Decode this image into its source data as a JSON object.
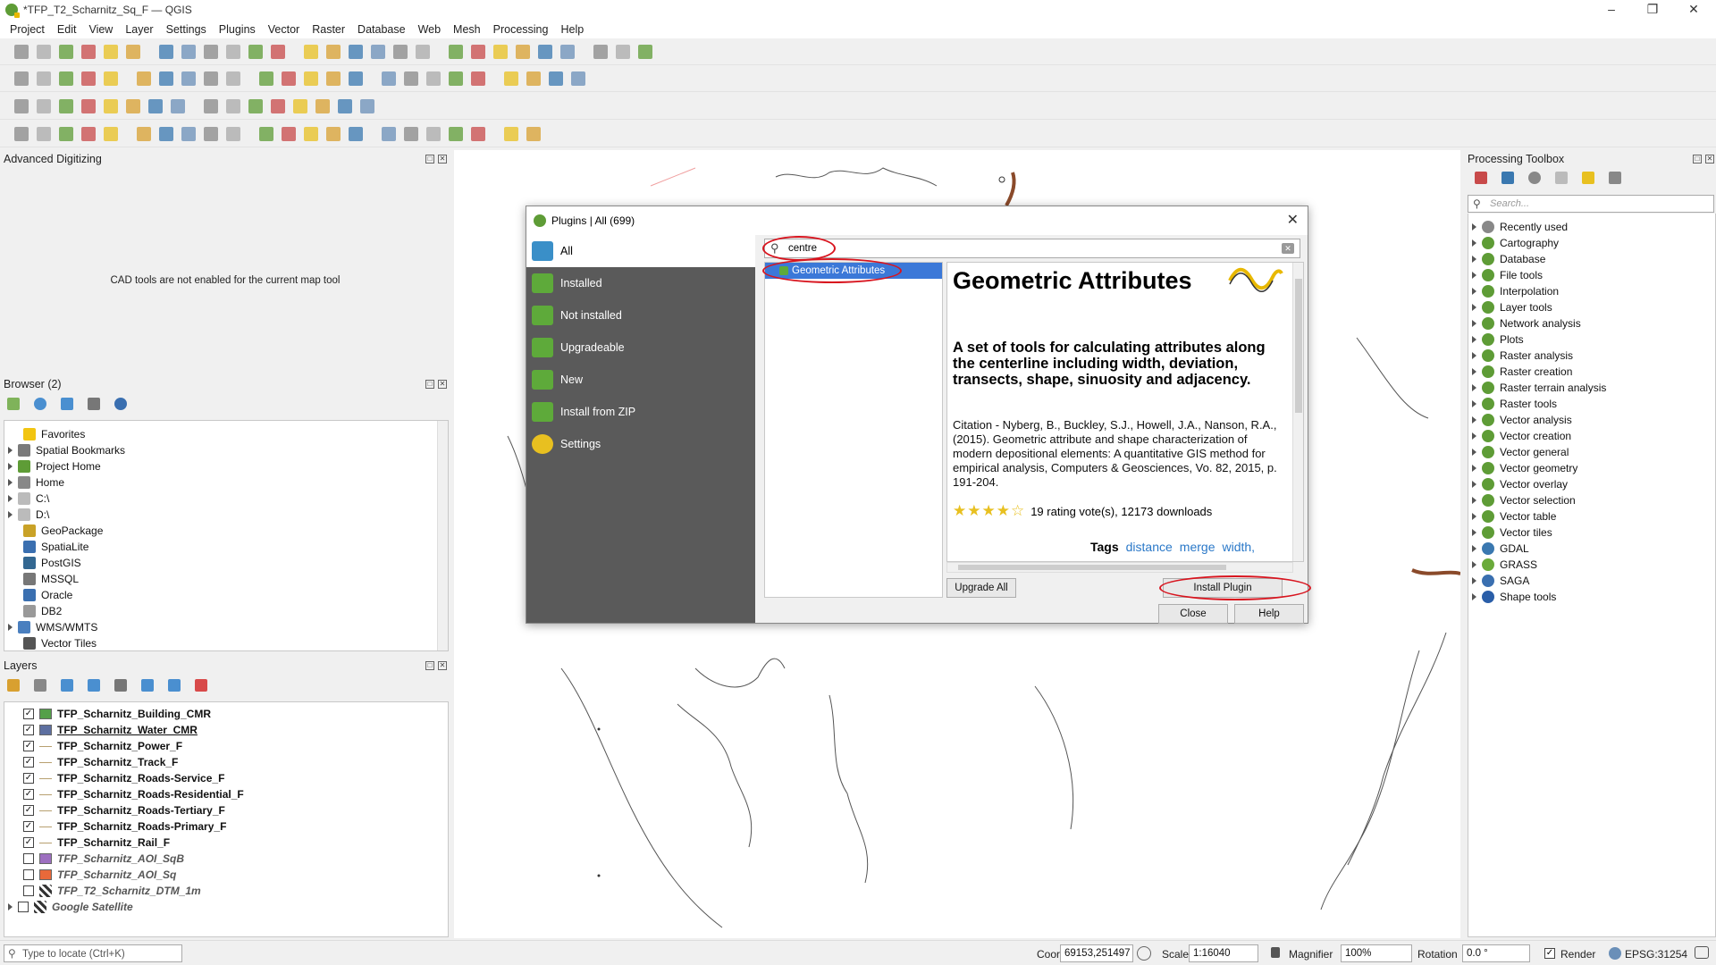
{
  "window": {
    "title": "*TFP_T2_Scharnitz_Sq_F — QGIS"
  },
  "menu": [
    "Project",
    "Edit",
    "View",
    "Layer",
    "Settings",
    "Plugins",
    "Vector",
    "Raster",
    "Database",
    "Web",
    "Mesh",
    "Processing",
    "Help"
  ],
  "advanced_digitizing": {
    "title": "Advanced Digitizing",
    "message": "CAD tools are not enabled for the current map tool"
  },
  "browser": {
    "title": "Browser (2)",
    "items": [
      {
        "label": "Favorites",
        "arrow": false,
        "icon": "star-icon",
        "color": "#f2c511"
      },
      {
        "label": "Spatial Bookmarks",
        "arrow": true,
        "icon": "bookmark-icon",
        "color": "#7a7a7a"
      },
      {
        "label": "Project Home",
        "arrow": true,
        "icon": "folder-icon",
        "color": "#5e9c36"
      },
      {
        "label": "Home",
        "arrow": true,
        "icon": "home-icon",
        "color": "#888"
      },
      {
        "label": "C:\\",
        "arrow": true,
        "icon": "drive-icon",
        "color": "#bbb"
      },
      {
        "label": "D:\\",
        "arrow": true,
        "icon": "drive-icon",
        "color": "#bbb"
      },
      {
        "label": "GeoPackage",
        "arrow": false,
        "icon": "geopackage-icon",
        "color": "#c9a227"
      },
      {
        "label": "SpatiaLite",
        "arrow": false,
        "icon": "spatialite-icon",
        "color": "#3a6fb0"
      },
      {
        "label": "PostGIS",
        "arrow": false,
        "icon": "postgis-icon",
        "color": "#336791"
      },
      {
        "label": "MSSQL",
        "arrow": false,
        "icon": "mssql-icon",
        "color": "#777"
      },
      {
        "label": "Oracle",
        "arrow": false,
        "icon": "oracle-icon",
        "color": "#3a6fb0"
      },
      {
        "label": "DB2",
        "arrow": false,
        "icon": "db2-icon",
        "color": "#999"
      },
      {
        "label": "WMS/WMTS",
        "arrow": true,
        "icon": "wms-icon",
        "color": "#4a7fbf"
      },
      {
        "label": "Vector Tiles",
        "arrow": false,
        "icon": "vector-tiles-icon",
        "color": "#555"
      }
    ]
  },
  "layers": {
    "title": "Layers",
    "items": [
      {
        "label": "TFP_Scharnitz_Building_CMR",
        "checked": true,
        "symbol": "fill",
        "color": "#55a04a",
        "italic": false
      },
      {
        "label": "TFP_Scharnitz_Water_CMR",
        "checked": true,
        "symbol": "fill",
        "color": "#5d6fa0",
        "italic": false,
        "underline": true
      },
      {
        "label": "TFP_Scharnitz_Power_F",
        "checked": true,
        "symbol": "line",
        "color": "#b8a070",
        "italic": false
      },
      {
        "label": "TFP_Scharnitz_Track_F",
        "checked": true,
        "symbol": "line",
        "color": "#b8a070",
        "italic": false
      },
      {
        "label": "TFP_Scharnitz_Roads-Service_F",
        "checked": true,
        "symbol": "line",
        "color": "#b8a070",
        "italic": false
      },
      {
        "label": "TFP_Scharnitz_Roads-Residential_F",
        "checked": true,
        "symbol": "line",
        "color": "#b8a070",
        "italic": false
      },
      {
        "label": "TFP_Scharnitz_Roads-Tertiary_F",
        "checked": true,
        "symbol": "line",
        "color": "#b8a070",
        "italic": false
      },
      {
        "label": "TFP_Scharnitz_Roads-Primary_F",
        "checked": true,
        "symbol": "line",
        "color": "#b8a070",
        "italic": false
      },
      {
        "label": "TFP_Scharnitz_Rail_F",
        "checked": true,
        "symbol": "line",
        "color": "#b8a070",
        "italic": false
      },
      {
        "label": "TFP_Scharnitz_AOI_SqB",
        "checked": false,
        "symbol": "fill",
        "color": "#9d6fc0",
        "italic": true
      },
      {
        "label": "TFP_Scharnitz_AOI_Sq",
        "checked": false,
        "symbol": "fill",
        "color": "#e8693a",
        "italic": true
      },
      {
        "label": "TFP_T2_Scharnitz_DTM_1m",
        "checked": false,
        "symbol": "raster",
        "color": "#333",
        "italic": true
      },
      {
        "label": "Google Satellite",
        "checked": false,
        "symbol": "raster",
        "color": "#333",
        "italic": true,
        "arrow": true
      }
    ]
  },
  "plugins_dialog": {
    "title": "Plugins | All (699)",
    "sidebar": [
      "All",
      "Installed",
      "Not installed",
      "Upgradeable",
      "New",
      "Install from ZIP",
      "Settings"
    ],
    "search_value": "centre",
    "results": [
      "Geometric Attributes"
    ],
    "detail": {
      "name": "Geometric Attributes",
      "summary": "A set of tools for calculating attributes along the centerline including width, deviation, transects, shape, sinuosity and adjacency.",
      "citation": "Citation - Nyberg, B., Buckley, S.J., Howell, J.A., Nanson, R.A., (2015). Geometric attribute and shape characterization of modern depositional elements: A quantitative GIS method for empirical analysis, Computers & Geosciences, Vo. 82, 2015, p. 191-204.",
      "rating_stars": 4,
      "rating_text": "19 rating vote(s), 12173 downloads",
      "tags_label": "Tags",
      "tags": [
        "distance",
        "merge",
        "width,"
      ]
    },
    "buttons": {
      "upgrade_all": "Upgrade All",
      "install": "Install Plugin",
      "close": "Close",
      "help": "Help"
    }
  },
  "processing_toolbox": {
    "title": "Processing Toolbox",
    "search_placeholder": "Search...",
    "items": [
      {
        "label": "Recently used",
        "icon": "clock-icon"
      },
      {
        "label": "Cartography",
        "icon": "qgis-icon"
      },
      {
        "label": "Database",
        "icon": "qgis-icon"
      },
      {
        "label": "File tools",
        "icon": "qgis-icon"
      },
      {
        "label": "Interpolation",
        "icon": "qgis-icon"
      },
      {
        "label": "Layer tools",
        "icon": "qgis-icon"
      },
      {
        "label": "Network analysis",
        "icon": "qgis-icon"
      },
      {
        "label": "Plots",
        "icon": "qgis-icon"
      },
      {
        "label": "Raster analysis",
        "icon": "qgis-icon"
      },
      {
        "label": "Raster creation",
        "icon": "qgis-icon"
      },
      {
        "label": "Raster terrain analysis",
        "icon": "qgis-icon"
      },
      {
        "label": "Raster tools",
        "icon": "qgis-icon"
      },
      {
        "label": "Vector analysis",
        "icon": "qgis-icon"
      },
      {
        "label": "Vector creation",
        "icon": "qgis-icon"
      },
      {
        "label": "Vector general",
        "icon": "qgis-icon"
      },
      {
        "label": "Vector geometry",
        "icon": "qgis-icon"
      },
      {
        "label": "Vector overlay",
        "icon": "qgis-icon"
      },
      {
        "label": "Vector selection",
        "icon": "qgis-icon"
      },
      {
        "label": "Vector table",
        "icon": "qgis-icon"
      },
      {
        "label": "Vector tiles",
        "icon": "qgis-icon"
      },
      {
        "label": "GDAL",
        "icon": "gdal-icon"
      },
      {
        "label": "GRASS",
        "icon": "grass-icon"
      },
      {
        "label": "SAGA",
        "icon": "saga-icon"
      },
      {
        "label": "Shape tools",
        "icon": "shape-tools-icon"
      }
    ]
  },
  "statusbar": {
    "locator_placeholder": "Type to locate (Ctrl+K)",
    "coordinate_label": "Coordinate",
    "coordinate_value": "69153,251497",
    "scale_label": "Scale",
    "scale_value": "1:16040",
    "magnifier_label": "Magnifier",
    "magnifier_value": "100%",
    "rotation_label": "Rotation",
    "rotation_value": "0.0 °",
    "render_label": "Render",
    "crs": "EPSG:31254"
  }
}
